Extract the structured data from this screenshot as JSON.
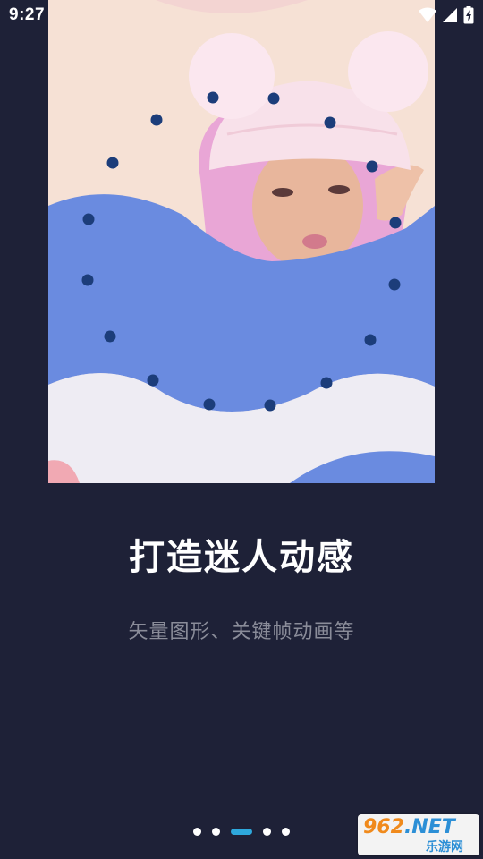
{
  "status_bar": {
    "time": "9:27",
    "icons": [
      "wifi-icon",
      "cell-signal-icon",
      "battery-charging-icon"
    ]
  },
  "hero": {
    "image": "woman-in-pink-bear-hat-icon",
    "colors": {
      "background": "#f7e2d6",
      "wave_blue": "#6a8be0",
      "wave_light": "#eeecf3",
      "dots": "#1c3d7a"
    },
    "dot_count": 16
  },
  "onboarding": {
    "title": "打造迷人动感",
    "subtitle": "矢量图形、关键帧动画等"
  },
  "pager": {
    "count": 5,
    "active_index": 2,
    "active_color": "#2ea8dc"
  },
  "watermark": {
    "brand_digits": "962",
    "brand_suffix": ".NET",
    "brand_cn": "乐游网"
  },
  "theme": {
    "background": "#1e2137",
    "title_color": "#ffffff",
    "subtitle_color": "#8a8c99"
  }
}
